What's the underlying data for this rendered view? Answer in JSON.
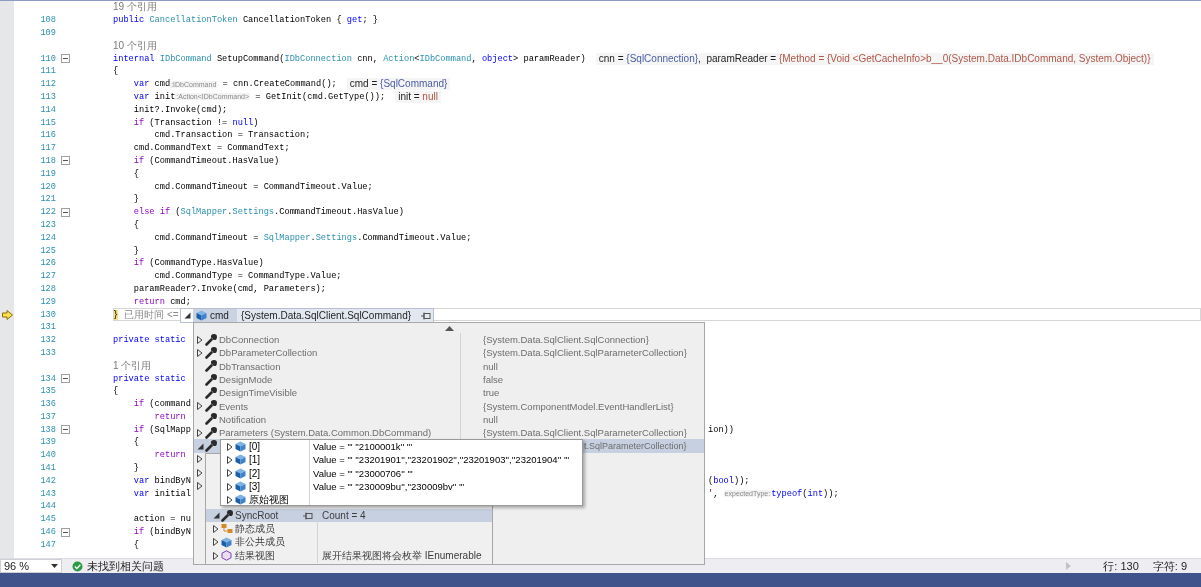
{
  "editor": {
    "lines": [
      {
        "kind": "ref",
        "text": "19 个引用"
      },
      {
        "kind": "code",
        "number": "108",
        "tokens": [
          {
            "kind": "keyword",
            "text": "public "
          },
          {
            "kind": "type",
            "text": "CancellationToken"
          },
          {
            "kind": "plain",
            "text": " CancellationToken { "
          },
          {
            "kind": "keyword",
            "text": "get"
          },
          {
            "kind": "plain",
            "text": "; }"
          }
        ]
      },
      {
        "kind": "code",
        "number": "109"
      },
      {
        "kind": "ref",
        "text": "10 个引用"
      },
      {
        "kind": "code",
        "number": "110",
        "fold": true,
        "tokens": [
          {
            "kind": "keyword",
            "text": "internal "
          },
          {
            "kind": "type",
            "text": "IDbCommand"
          },
          {
            "kind": "plain",
            "text": " SetupCommand("
          },
          {
            "kind": "type",
            "text": "IDbConnection"
          },
          {
            "kind": "plain",
            "text": " cnn, "
          },
          {
            "kind": "type",
            "text": "Action"
          },
          {
            "kind": "plain",
            "text": "<"
          },
          {
            "kind": "type",
            "text": "IDbCommand"
          },
          {
            "kind": "plain",
            "text": ", "
          },
          {
            "kind": "keyword",
            "text": "object"
          },
          {
            "kind": "plain",
            "text": "> paramReader)"
          },
          {
            "kind": "tip",
            "text": "cnn = "
          },
          {
            "kind": "tip-object",
            "text": "{SqlConnection}"
          },
          {
            "kind": "tip",
            "text": ",  paramReader = "
          },
          {
            "kind": "tip-value",
            "text": "{Method = {Void <GetCacheInfo>b__0(System.Data.IDbCommand, System.Object)}"
          }
        ]
      },
      {
        "kind": "code",
        "number": "111",
        "tokens": [
          {
            "kind": "plain",
            "text": "{"
          }
        ]
      },
      {
        "kind": "code",
        "number": "112",
        "tokens": [
          {
            "kind": "keyword",
            "text": "    var "
          },
          {
            "kind": "plain",
            "text": "cmd"
          },
          {
            "kind": "hint",
            "text": ":IDbCommand"
          },
          {
            "kind": "plain",
            "text": " = cnn.CreateCommand();"
          },
          {
            "kind": "tip",
            "text": "cmd = "
          },
          {
            "kind": "tip-object",
            "text": "{SqlCommand}"
          }
        ]
      },
      {
        "kind": "code",
        "number": "113",
        "tokens": [
          {
            "kind": "keyword",
            "text": "    var "
          },
          {
            "kind": "plain",
            "text": "init"
          },
          {
            "kind": "hint",
            "text": ":Action<IDbCommand>"
          },
          {
            "kind": "plain",
            "text": " = GetInit(cmd.GetType());"
          },
          {
            "kind": "tip",
            "text": "init = "
          },
          {
            "kind": "tip-value",
            "text": "null"
          }
        ]
      },
      {
        "kind": "code",
        "number": "114",
        "tokens": [
          {
            "kind": "plain",
            "text": "    init?.Invoke(cmd);"
          }
        ]
      },
      {
        "kind": "code",
        "number": "115",
        "tokens": [
          {
            "kind": "control",
            "text": "    if"
          },
          {
            "kind": "plain",
            "text": " (Transaction != "
          },
          {
            "kind": "keyword",
            "text": "null"
          },
          {
            "kind": "plain",
            "text": ")"
          }
        ]
      },
      {
        "kind": "code",
        "number": "116",
        "tokens": [
          {
            "kind": "plain",
            "text": "        cmd.Transaction = Transaction;"
          }
        ]
      },
      {
        "kind": "code",
        "number": "117",
        "tokens": [
          {
            "kind": "plain",
            "text": "    cmd.CommandText = CommandText;"
          }
        ]
      },
      {
        "kind": "code",
        "number": "118",
        "fold": true,
        "tokens": [
          {
            "kind": "control",
            "text": "    if"
          },
          {
            "kind": "plain",
            "text": " (CommandTimeout.HasValue)"
          }
        ]
      },
      {
        "kind": "code",
        "number": "119",
        "tokens": [
          {
            "kind": "plain",
            "text": "    {"
          }
        ]
      },
      {
        "kind": "code",
        "number": "120",
        "tokens": [
          {
            "kind": "plain",
            "text": "        cmd.CommandTimeout = CommandTimeout.Value;"
          }
        ]
      },
      {
        "kind": "code",
        "number": "121",
        "tokens": [
          {
            "kind": "plain",
            "text": "    }"
          }
        ]
      },
      {
        "kind": "code",
        "number": "122",
        "fold": true,
        "tokens": [
          {
            "kind": "control",
            "text": "    else if"
          },
          {
            "kind": "plain",
            "text": " ("
          },
          {
            "kind": "type",
            "text": "SqlMapper"
          },
          {
            "kind": "plain",
            "text": "."
          },
          {
            "kind": "type",
            "text": "Settings"
          },
          {
            "kind": "plain",
            "text": ".CommandTimeout.HasValue)"
          }
        ]
      },
      {
        "kind": "code",
        "number": "123",
        "tokens": [
          {
            "kind": "plain",
            "text": "    {"
          }
        ]
      },
      {
        "kind": "code",
        "number": "124",
        "tokens": [
          {
            "kind": "plain",
            "text": "        cmd.CommandTimeout = "
          },
          {
            "kind": "type",
            "text": "SqlMapper"
          },
          {
            "kind": "plain",
            "text": "."
          },
          {
            "kind": "type",
            "text": "Settings"
          },
          {
            "kind": "plain",
            "text": ".CommandTimeout.Value;"
          }
        ]
      },
      {
        "kind": "code",
        "number": "125",
        "tokens": [
          {
            "kind": "plain",
            "text": "    }"
          }
        ]
      },
      {
        "kind": "code",
        "number": "126",
        "tokens": [
          {
            "kind": "control",
            "text": "    if"
          },
          {
            "kind": "plain",
            "text": " (CommandType.HasValue)"
          }
        ]
      },
      {
        "kind": "code",
        "number": "127",
        "tokens": [
          {
            "kind": "plain",
            "text": "        cmd.CommandType = CommandType.Value;"
          }
        ]
      },
      {
        "kind": "code",
        "number": "128",
        "tokens": [
          {
            "kind": "plain",
            "text": "    paramReader?.Invoke(cmd, Parameters);"
          }
        ]
      },
      {
        "kind": "code",
        "number": "129",
        "tokens": [
          {
            "kind": "control",
            "text": "    return"
          },
          {
            "kind": "plain",
            "text": " cmd;"
          }
        ]
      },
      {
        "kind": "code",
        "number": "130",
        "current": true,
        "tokens": [
          {
            "kind": "brace",
            "text": "}"
          },
          {
            "kind": "elapsed",
            "text": "已用时间 <="
          }
        ]
      },
      {
        "kind": "code",
        "number": "131"
      },
      {
        "kind": "code",
        "number": "132",
        "tokens": [
          {
            "kind": "keyword",
            "text": "private static"
          }
        ]
      },
      {
        "kind": "code",
        "number": "133"
      },
      {
        "kind": "ref",
        "text": "1 个引用"
      },
      {
        "kind": "code",
        "number": "134",
        "fold": true,
        "tokens": [
          {
            "kind": "keyword",
            "text": "private static"
          }
        ]
      },
      {
        "kind": "code",
        "number": "135",
        "tokens": [
          {
            "kind": "plain",
            "text": "{"
          }
        ]
      },
      {
        "kind": "code",
        "number": "136",
        "tokens": [
          {
            "kind": "control",
            "text": "    if"
          },
          {
            "kind": "plain",
            "text": " (command"
          }
        ]
      },
      {
        "kind": "code",
        "number": "137",
        "tokens": [
          {
            "kind": "control",
            "text": "        return"
          }
        ]
      },
      {
        "kind": "code",
        "number": "138",
        "fold": true,
        "tokens": [
          {
            "kind": "control",
            "text": "    if"
          },
          {
            "kind": "plain",
            "text": " (SqlMapp"
          }
        ],
        "tail": [
          {
            "kind": "plain",
            "text": "ion))"
          }
        ]
      },
      {
        "kind": "code",
        "number": "139",
        "tokens": [
          {
            "kind": "plain",
            "text": "    {"
          }
        ]
      },
      {
        "kind": "code",
        "number": "140",
        "tokens": [
          {
            "kind": "control",
            "text": "        return"
          }
        ]
      },
      {
        "kind": "code",
        "number": "141",
        "tokens": [
          {
            "kind": "plain",
            "text": "    }"
          }
        ]
      },
      {
        "kind": "code",
        "number": "142",
        "tokens": [
          {
            "kind": "keyword",
            "text": "    var"
          },
          {
            "kind": "plain",
            "text": " bindByN"
          }
        ],
        "tail": [
          {
            "kind": "plain",
            "text": "("
          },
          {
            "kind": "keyword",
            "text": "bool"
          },
          {
            "kind": "plain",
            "text": "));"
          }
        ]
      },
      {
        "kind": "code",
        "number": "143",
        "tokens": [
          {
            "kind": "keyword",
            "text": "    var"
          },
          {
            "kind": "plain",
            "text": " initial"
          }
        ],
        "tail": [
          {
            "kind": "string",
            "text": "'"
          },
          {
            "kind": "plain",
            "text": ", "
          },
          {
            "kind": "hint",
            "text": "expectedType:"
          },
          {
            "kind": "keyword",
            "text": "typeof"
          },
          {
            "kind": "plain",
            "text": "("
          },
          {
            "kind": "keyword",
            "text": "int"
          },
          {
            "kind": "plain",
            "text": "));"
          }
        ]
      },
      {
        "kind": "code",
        "number": "144"
      },
      {
        "kind": "code",
        "number": "145",
        "tokens": [
          {
            "kind": "plain",
            "text": "    action = nu"
          }
        ]
      },
      {
        "kind": "code",
        "number": "146",
        "fold": true,
        "tokens": [
          {
            "kind": "control",
            "text": "    if"
          },
          {
            "kind": "plain",
            "text": " (bindByN"
          }
        ]
      },
      {
        "kind": "code",
        "number": "147",
        "tokens": [
          {
            "kind": "plain",
            "text": "    {"
          }
        ]
      }
    ]
  },
  "datatip": {
    "name": "cmd",
    "value": "{System.Data.SqlClient.SqlCommand}",
    "expanded": true,
    "members": [
      {
        "name": "DbConnection",
        "value": "{System.Data.SqlClient.SqlConnection}",
        "kind": "property",
        "expanded": false,
        "selected": false
      },
      {
        "name": "DbParameterCollection",
        "value": "{System.Data.SqlClient.SqlParameterCollection}",
        "kind": "property",
        "expanded": false,
        "selected": false
      },
      {
        "name": "DbTransaction",
        "value": "null",
        "kind": "property",
        "selected": false
      },
      {
        "name": "DesignMode",
        "value": "false",
        "kind": "property",
        "selected": false
      },
      {
        "name": "DesignTimeVisible",
        "value": "true",
        "kind": "property",
        "selected": false
      },
      {
        "name": "Events",
        "value": "{System.ComponentModel.EventHandlerList}",
        "kind": "property",
        "expanded": false,
        "selected": false
      },
      {
        "name": "Notification",
        "value": "null",
        "kind": "property",
        "selected": false
      },
      {
        "name": "Parameters (System.Data.Common.DbCommand)",
        "value": "{System.Data.SqlClient.SqlParameterCollection}",
        "kind": "property",
        "expanded": false,
        "selected": false
      },
      {
        "value": "t.SqlParameterCollection}",
        "kind": "property",
        "expanded": true,
        "selected": true,
        "children": [
          {
            "name": "SyncRoot",
            "value": "Count = 4",
            "kind": "property",
            "expanded": true,
            "selected": true,
            "children": [
              {
                "name": "[0]",
                "value": "Value = \"' ''2100001k'' '\"",
                "kind": "object",
                "expanded": false,
                "selected": false
              },
              {
                "name": "[1]",
                "value": "Value = \"' ''23201901'',''23201902'',''23201903'',''23201904'' '\"",
                "kind": "object",
                "expanded": false,
                "selected": false
              },
              {
                "name": "[2]",
                "value": "Value = \"' ''23000706'' '\"",
                "kind": "object",
                "expanded": false,
                "selected": false
              },
              {
                "name": "[3]",
                "value": "Value = \"' ''230009bu'',''230009bv'' '\"",
                "kind": "object",
                "expanded": false,
                "selected": false
              },
              {
                "name": "原始视图",
                "kind": "object",
                "expanded": false,
                "selected": false
              }
            ]
          },
          {
            "name": "静态成员",
            "kind": "static",
            "expanded": false,
            "selected": false
          },
          {
            "name": "非公共成员",
            "kind": "object",
            "expanded": false,
            "selected": false
          },
          {
            "name": "结果视图",
            "value": "展开结果视图将会枚举 IEnumerable",
            "kind": "view",
            "expanded": false,
            "selected": false
          }
        ]
      },
      {
        "expanded": false,
        "selected": false
      },
      {
        "expanded": false,
        "selected": false
      },
      {
        "expanded": false,
        "selected": false
      }
    ]
  },
  "status_bar": {
    "zoom": "96 %",
    "issues": "未找到相关问题",
    "line": "行: 130",
    "column": "字符: 9"
  }
}
